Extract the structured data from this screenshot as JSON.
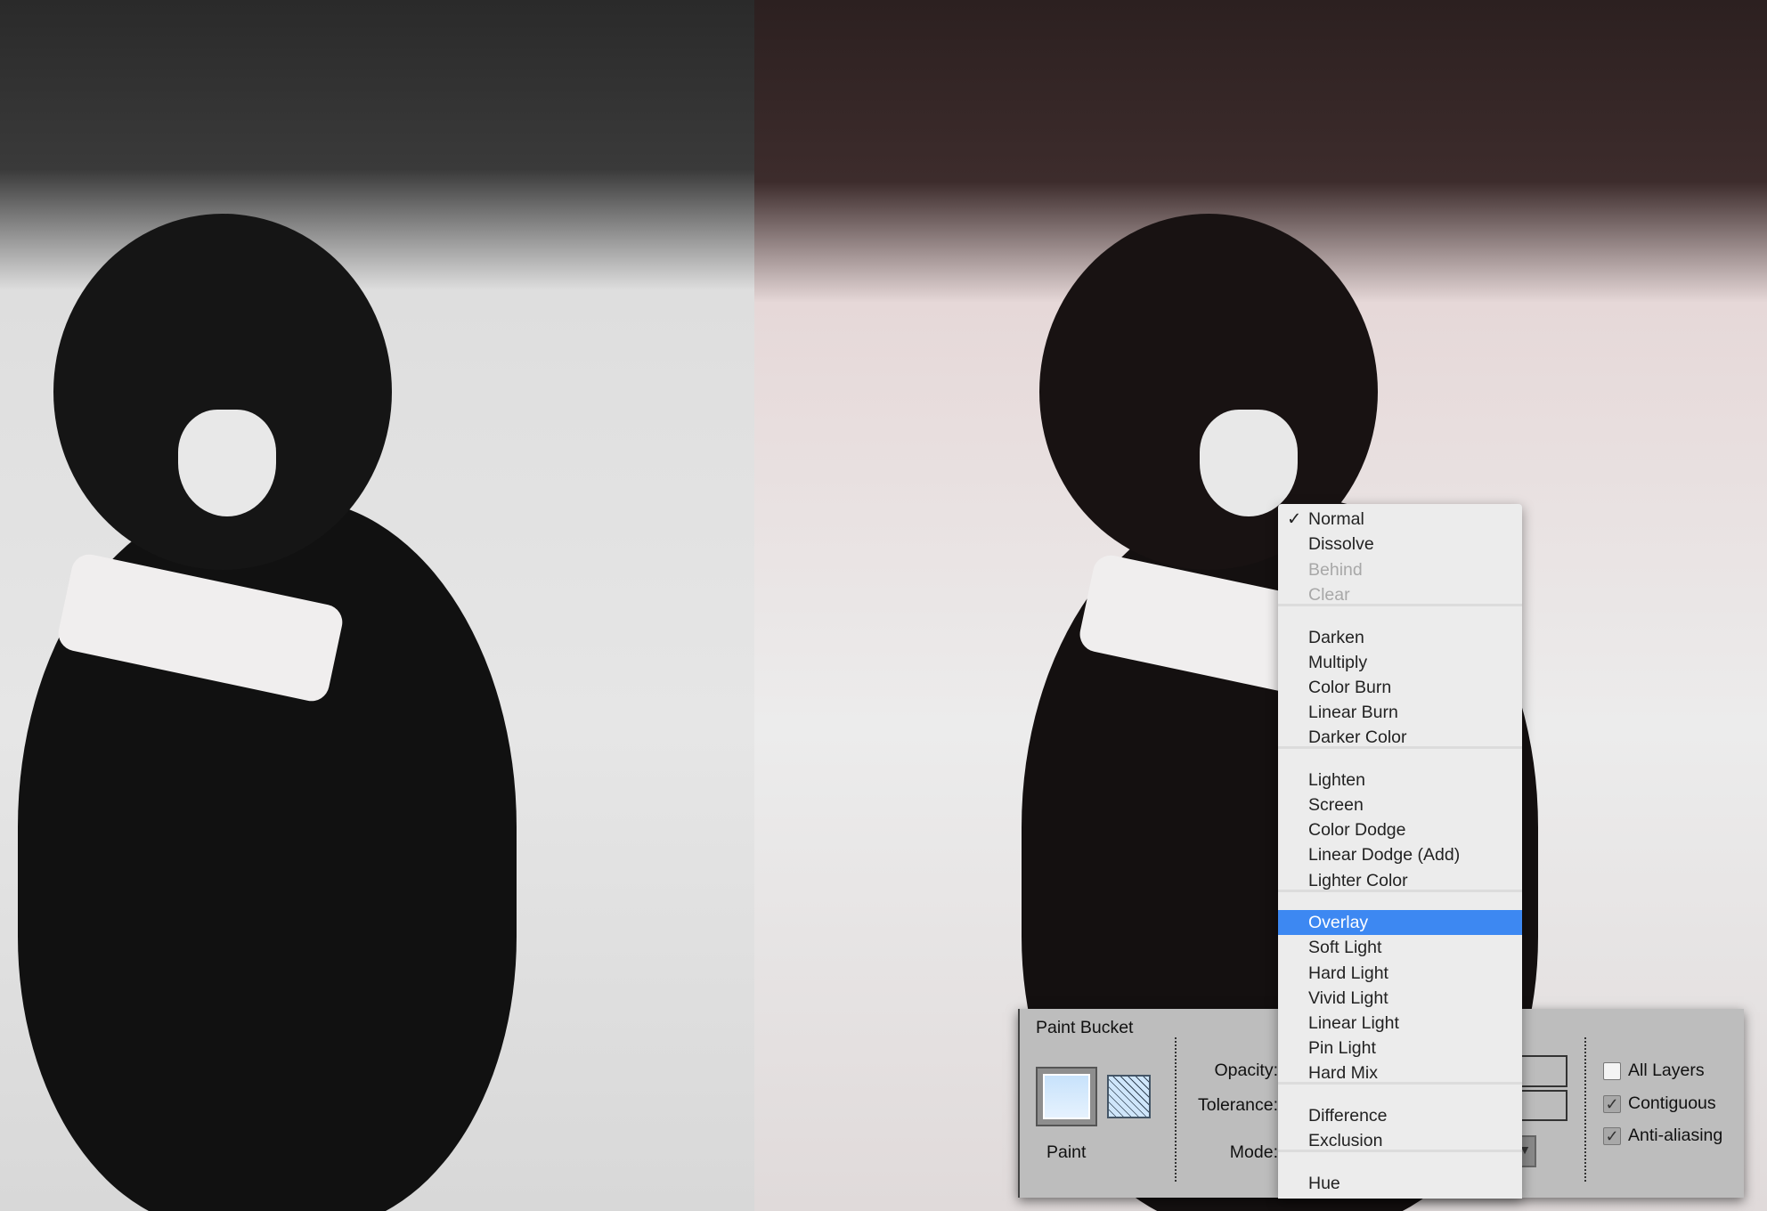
{
  "blend_menu": {
    "items": [
      {
        "label": "Normal",
        "checked": true
      },
      {
        "label": "Dissolve"
      },
      {
        "label": "Behind",
        "disabled": true
      },
      {
        "label": "Clear",
        "disabled": true
      },
      {
        "label": "Darken"
      },
      {
        "label": "Multiply"
      },
      {
        "label": "Color Burn"
      },
      {
        "label": "Linear Burn"
      },
      {
        "label": "Darker Color"
      },
      {
        "label": "Lighten"
      },
      {
        "label": "Screen"
      },
      {
        "label": "Color Dodge"
      },
      {
        "label": "Linear Dodge (Add)"
      },
      {
        "label": "Lighter Color"
      },
      {
        "label": "Overlay",
        "highlighted": true
      },
      {
        "label": "Soft Light"
      },
      {
        "label": "Hard Light"
      },
      {
        "label": "Vivid Light"
      },
      {
        "label": "Linear Light"
      },
      {
        "label": "Pin Light"
      },
      {
        "label": "Hard Mix"
      },
      {
        "label": "Difference"
      },
      {
        "label": "Exclusion"
      },
      {
        "label": "Hue"
      }
    ],
    "check_icon": "checkmark-icon",
    "highlight_color": "#3d88f2"
  },
  "tool_panel": {
    "title": "Paint Bucket",
    "source_label": "Paint",
    "opacity_label": "Opacity:",
    "opacity_suffix": "%",
    "tolerance_label": "Tolerance:",
    "mode_label": "Mode:",
    "all_layers": {
      "label": "All Layers",
      "checked": false
    },
    "contiguous": {
      "label": "Contiguous",
      "checked": true
    },
    "anti_aliasing": {
      "label": "Anti-aliasing",
      "checked": true
    }
  }
}
